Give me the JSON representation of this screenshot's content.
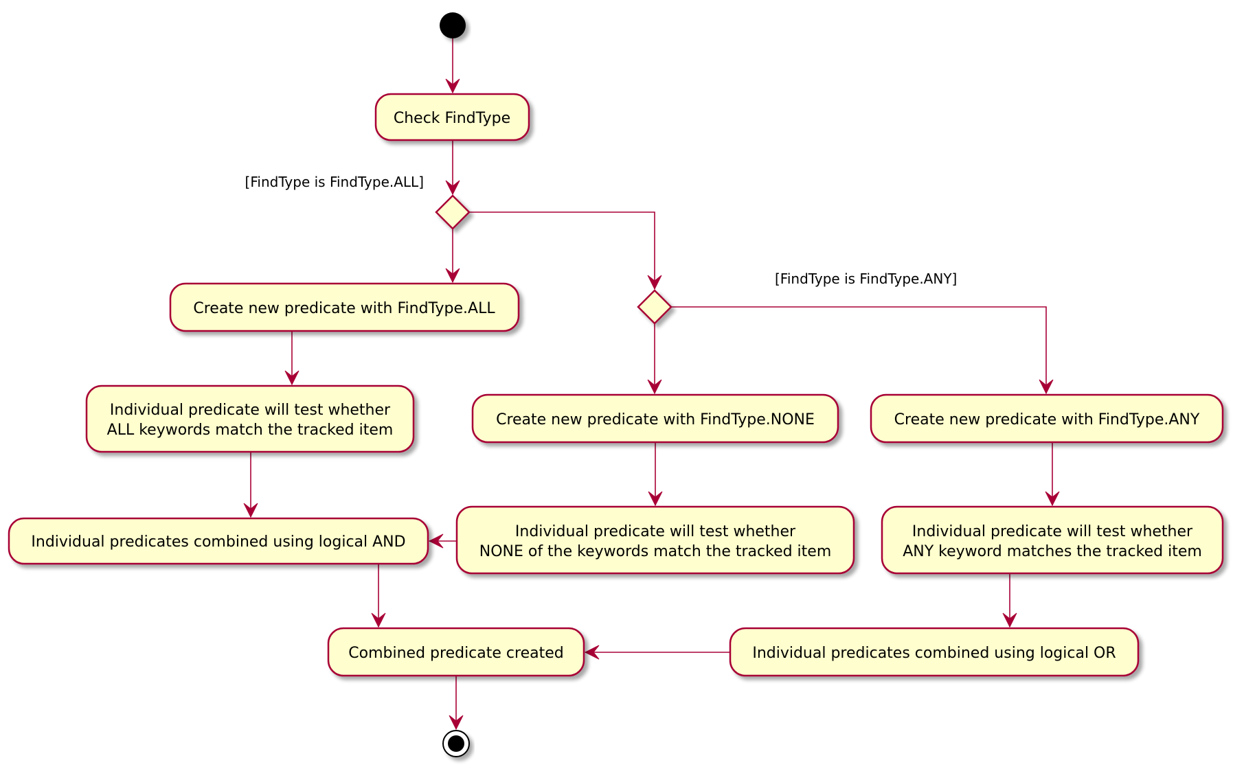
{
  "diagram": {
    "type": "activity",
    "colors": {
      "node_fill": "#FEFECE",
      "node_border": "#A80036",
      "edge": "#A80036",
      "start_end": "#000000"
    },
    "nodes": {
      "check": {
        "label": "Check FindType"
      },
      "create_all": {
        "label": "Create new predicate with FindType.ALL"
      },
      "test_all": {
        "line1": "Individual predicate will test whether",
        "line2": "ALL keywords match the tracked item"
      },
      "and": {
        "label": "Individual predicates combined using logical AND"
      },
      "create_none": {
        "label": "Create new predicate with FindType.NONE"
      },
      "create_any": {
        "label": "Create new predicate with FindType.ANY"
      },
      "test_none": {
        "line1": "Individual predicate will test whether",
        "line2": "NONE of the keywords match the tracked item"
      },
      "test_any": {
        "line1": "Individual predicate will test whether",
        "line2": "ANY keyword matches the tracked item"
      },
      "combined": {
        "label": "Combined predicate created"
      },
      "or": {
        "label": "Individual predicates combined using logical OR"
      }
    },
    "guards": {
      "all": "[FindType is FindType.ALL]",
      "any": "[FindType is FindType.ANY]"
    }
  }
}
